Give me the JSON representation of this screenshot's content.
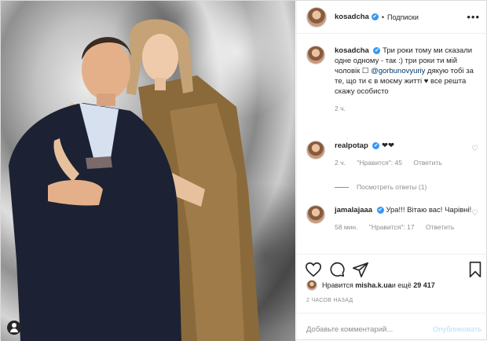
{
  "header": {
    "username": "kosadcha",
    "verified": "✔",
    "separator": "•",
    "follow_label": "Подписки",
    "more": "•••"
  },
  "caption": {
    "username": "kosadcha",
    "verified": "✔",
    "text_1": "Три роки тому ми сказали одне одному - так :) три роки ти мій чоловік ",
    "emoji_box": "☐",
    "mention": "@gorbunovyuriy",
    "text_2": " дякую тобі за те, що ти є в моєму житті ",
    "heart": "♥",
    "text_3": " все решта скажу особисто",
    "time": "2 ч."
  },
  "comments": [
    {
      "username": "realpotap",
      "verified": "✔",
      "text": "❤❤",
      "time": "2 ч.",
      "likes": "\"Нравится\": 45",
      "reply": "Ответить",
      "view_replies": "Посмотреть ответы (1)"
    },
    {
      "username": "jamalajaaa",
      "verified": "✔",
      "text": "Ура!!! Вітаю вас! Чарівні!",
      "time": "58 мин.",
      "likes": "\"Нравится\": 17",
      "reply": "Ответить"
    }
  ],
  "likes_line": {
    "prefix": "Нравится ",
    "user": "misha.k.ua",
    "middle": " и ещё ",
    "count": "29 417"
  },
  "posted_ago": "2 ЧАСОВ НАЗАД",
  "comment_box": {
    "placeholder": "Добавьте комментарий...",
    "publish_label": "Опубликовать"
  },
  "icons": {
    "like": "heart-icon",
    "comment": "comment-icon",
    "share": "share-icon",
    "save": "bookmark-icon",
    "comment_like": "small-heart-icon",
    "tag": "user-tag-icon"
  },
  "colors": {
    "link": "#00376b",
    "verified": "#3897f0",
    "muted": "#8e8e8e",
    "publish_disabled": "#b2dffc",
    "border": "#dbdbdb"
  }
}
